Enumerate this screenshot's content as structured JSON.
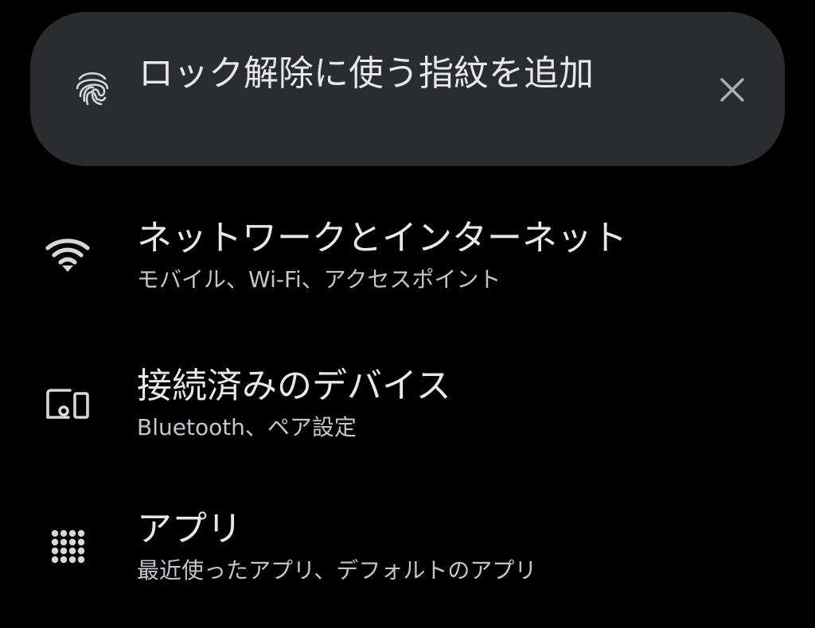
{
  "suggestion": {
    "title": "ロック解除に使う指紋を追加",
    "icon": "fingerprint-icon",
    "dismiss_icon": "close-icon"
  },
  "settings": [
    {
      "title": "ネットワークとインターネット",
      "summary": "モバイル、Wi-Fi、アクセスポイント",
      "icon": "wifi-icon"
    },
    {
      "title": "接続済みのデバイス",
      "summary": "Bluetooth、ペア設定",
      "icon": "devices-icon"
    },
    {
      "title": "アプリ",
      "summary": "最近使ったアプリ、デフォルトのアプリ",
      "icon": "apps-grid-icon"
    }
  ],
  "colors": {
    "background": "#000000",
    "card": "#2a2c30",
    "primary_text": "#e8e8ea",
    "secondary_text": "#c4c6cb",
    "icon": "#d6d7da"
  }
}
